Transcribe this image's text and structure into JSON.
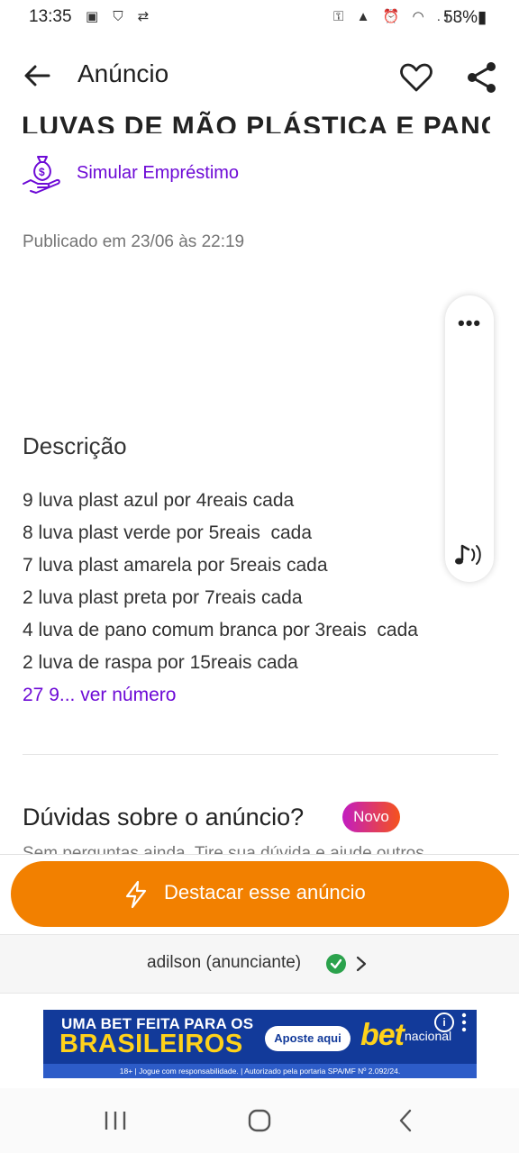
{
  "status_bar": {
    "time": "13:35",
    "left_icons": "▣ ⛉ ⇄",
    "right_icons": "⚿ ▲ ⏰ ◠ .ıl",
    "battery": "53%▮"
  },
  "header": {
    "title": "Anúncio"
  },
  "ad": {
    "title": "LUVAS DE MÃO PLÁSTICA E PANO",
    "loan_link": "Simular Empréstimo",
    "published": "Publicado em 23/06 às 22:19",
    "description_heading": "Descrição",
    "description_lines": [
      "9 luva plast azul por 4reais cada",
      "8 luva plast verde por 5reais  cada",
      "7 luva plast amarela por 5reais cada",
      "2 luva plast preta por 7reais cada",
      "4 luva de pano comum branca por 3reais  cada",
      "2 luva de raspa por 15reais cada"
    ],
    "see_number": "27 9... ver número"
  },
  "side_widget": {
    "more": "•••"
  },
  "questions": {
    "heading": "Dúvidas sobre o anúncio?",
    "badge": "Novo",
    "empty_text": "Sem perguntas ainda. Tire sua dúvida e ajude outros"
  },
  "bottom": {
    "highlight_button": "Destacar esse anúncio",
    "advertiser": "adilson (anunciante)"
  },
  "banner": {
    "line1": "UMA BET FEITA PARA OS",
    "line2": "BRASILEIROS",
    "cta": "Aposte aqui",
    "brand_big": "bet",
    "brand_small": "nacional",
    "info": "i",
    "disclaimer": "18+ | Jogue com responsabilidade. | Autorizado pela portaria SPA/MF Nº 2.092/24."
  },
  "colors": {
    "accent_purple": "#6d0ad6",
    "highlight_orange": "#f28000",
    "verified_green": "#2ba24c"
  }
}
